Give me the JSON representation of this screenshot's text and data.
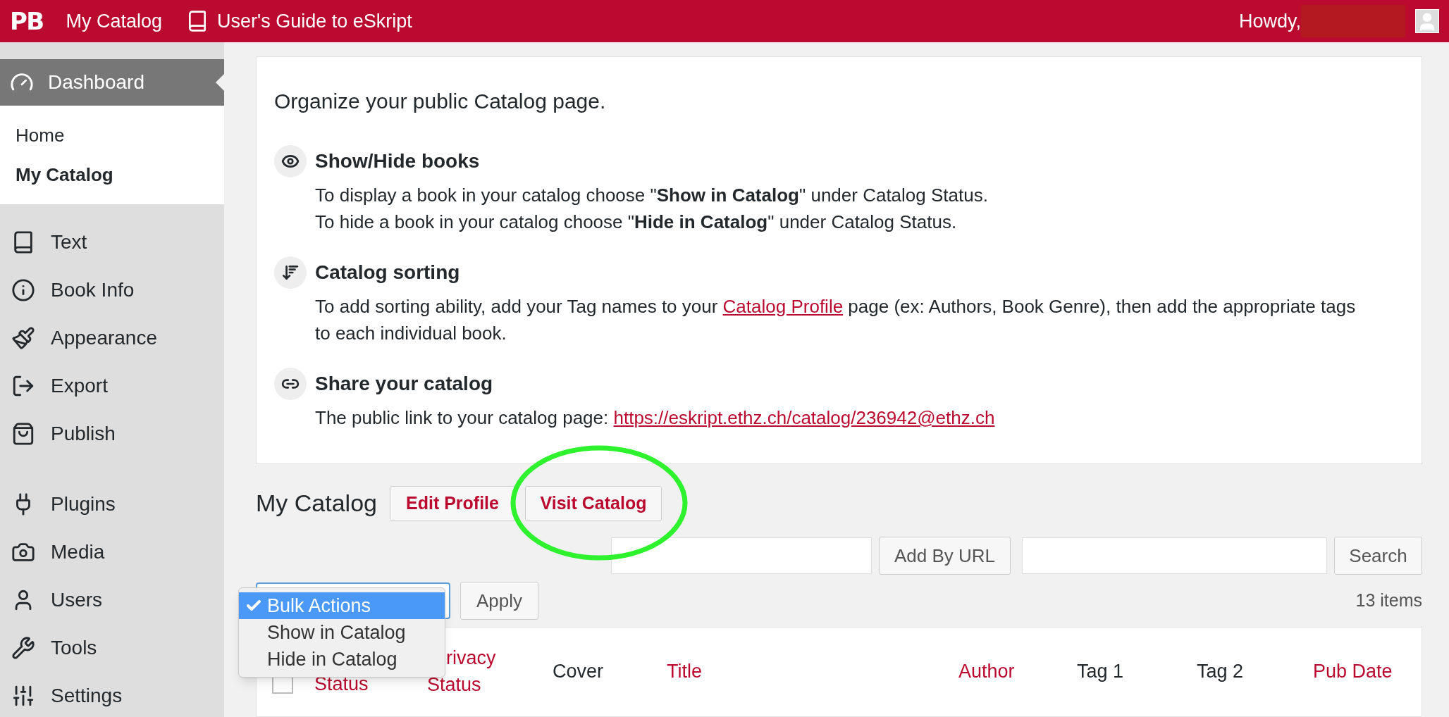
{
  "top_bar": {
    "logo": "PB",
    "links": [
      {
        "label": "My Catalog",
        "kind": "plain"
      },
      {
        "label": "User's Guide to eSkript",
        "kind": "book"
      }
    ],
    "greeting": "Howdy,"
  },
  "sidebar": {
    "dashboard": {
      "label": "Dashboard",
      "selected": true
    },
    "submenu": [
      {
        "label": "Home",
        "selected": false
      },
      {
        "label": "My Catalog",
        "selected": true
      }
    ],
    "groups": [
      [
        {
          "label": "Text"
        },
        {
          "label": "Book Info"
        },
        {
          "label": "Appearance"
        },
        {
          "label": "Export"
        },
        {
          "label": "Publish"
        }
      ],
      [
        {
          "label": "Plugins"
        },
        {
          "label": "Media"
        },
        {
          "label": "Users"
        },
        {
          "label": "Tools"
        },
        {
          "label": "Settings"
        }
      ]
    ]
  },
  "intro": {
    "lead": "Organize your public Catalog page.",
    "sections": [
      {
        "title": "Show/Hide books",
        "paragraphs": [
          [
            {
              "text": "To display a book in your catalog choose \"**Show in Catalog**\" under Catalog Status.",
              "link": false
            }
          ],
          [
            {
              "text": "To hide a book in your catalog choose \"**Hide in Catalog**\" under Catalog Status.",
              "link": false
            }
          ]
        ]
      },
      {
        "title": "Catalog sorting",
        "paragraphs": [
          [
            {
              "text": "To add sorting ability, add your Tag names to your ",
              "link": false
            },
            {
              "text": "Catalog Profile",
              "link": true
            },
            {
              "text": " page (ex: Authors, Book Genre), then add the appropriate tags to each individual book.",
              "link": false
            }
          ]
        ]
      },
      {
        "title": "Share your catalog",
        "paragraphs": [
          [
            {
              "text": "The public link to your catalog page: ",
              "link": false
            },
            {
              "text": "https://eskript.ethz.ch/catalog/236942@ethz.ch",
              "link": true
            }
          ]
        ]
      }
    ]
  },
  "catalog": {
    "heading": "My Catalog",
    "buttons": [
      "Edit Profile",
      "Visit Catalog"
    ],
    "add_button": "Add By URL",
    "search_button": "Search",
    "bulk": {
      "options": [
        {
          "label": "Bulk Actions",
          "selected": true
        },
        {
          "label": "Show in Catalog",
          "selected": false
        },
        {
          "label": "Hide in Catalog",
          "selected": false
        }
      ],
      "apply": "Apply"
    },
    "count": "13 items",
    "select_all": {
      "checked": false
    },
    "columns": [
      {
        "label": "Status",
        "sortable": true
      },
      {
        "label": "rivacy Status",
        "sortable": true
      },
      {
        "label": "Cover",
        "sortable": false
      },
      {
        "label": "Title",
        "sortable": true
      },
      {
        "label": "Author",
        "sortable": true
      },
      {
        "label": "Tag 1",
        "sortable": false
      },
      {
        "label": "Tag 2",
        "sortable": false
      },
      {
        "label": "Pub Date",
        "sortable": true
      }
    ]
  }
}
